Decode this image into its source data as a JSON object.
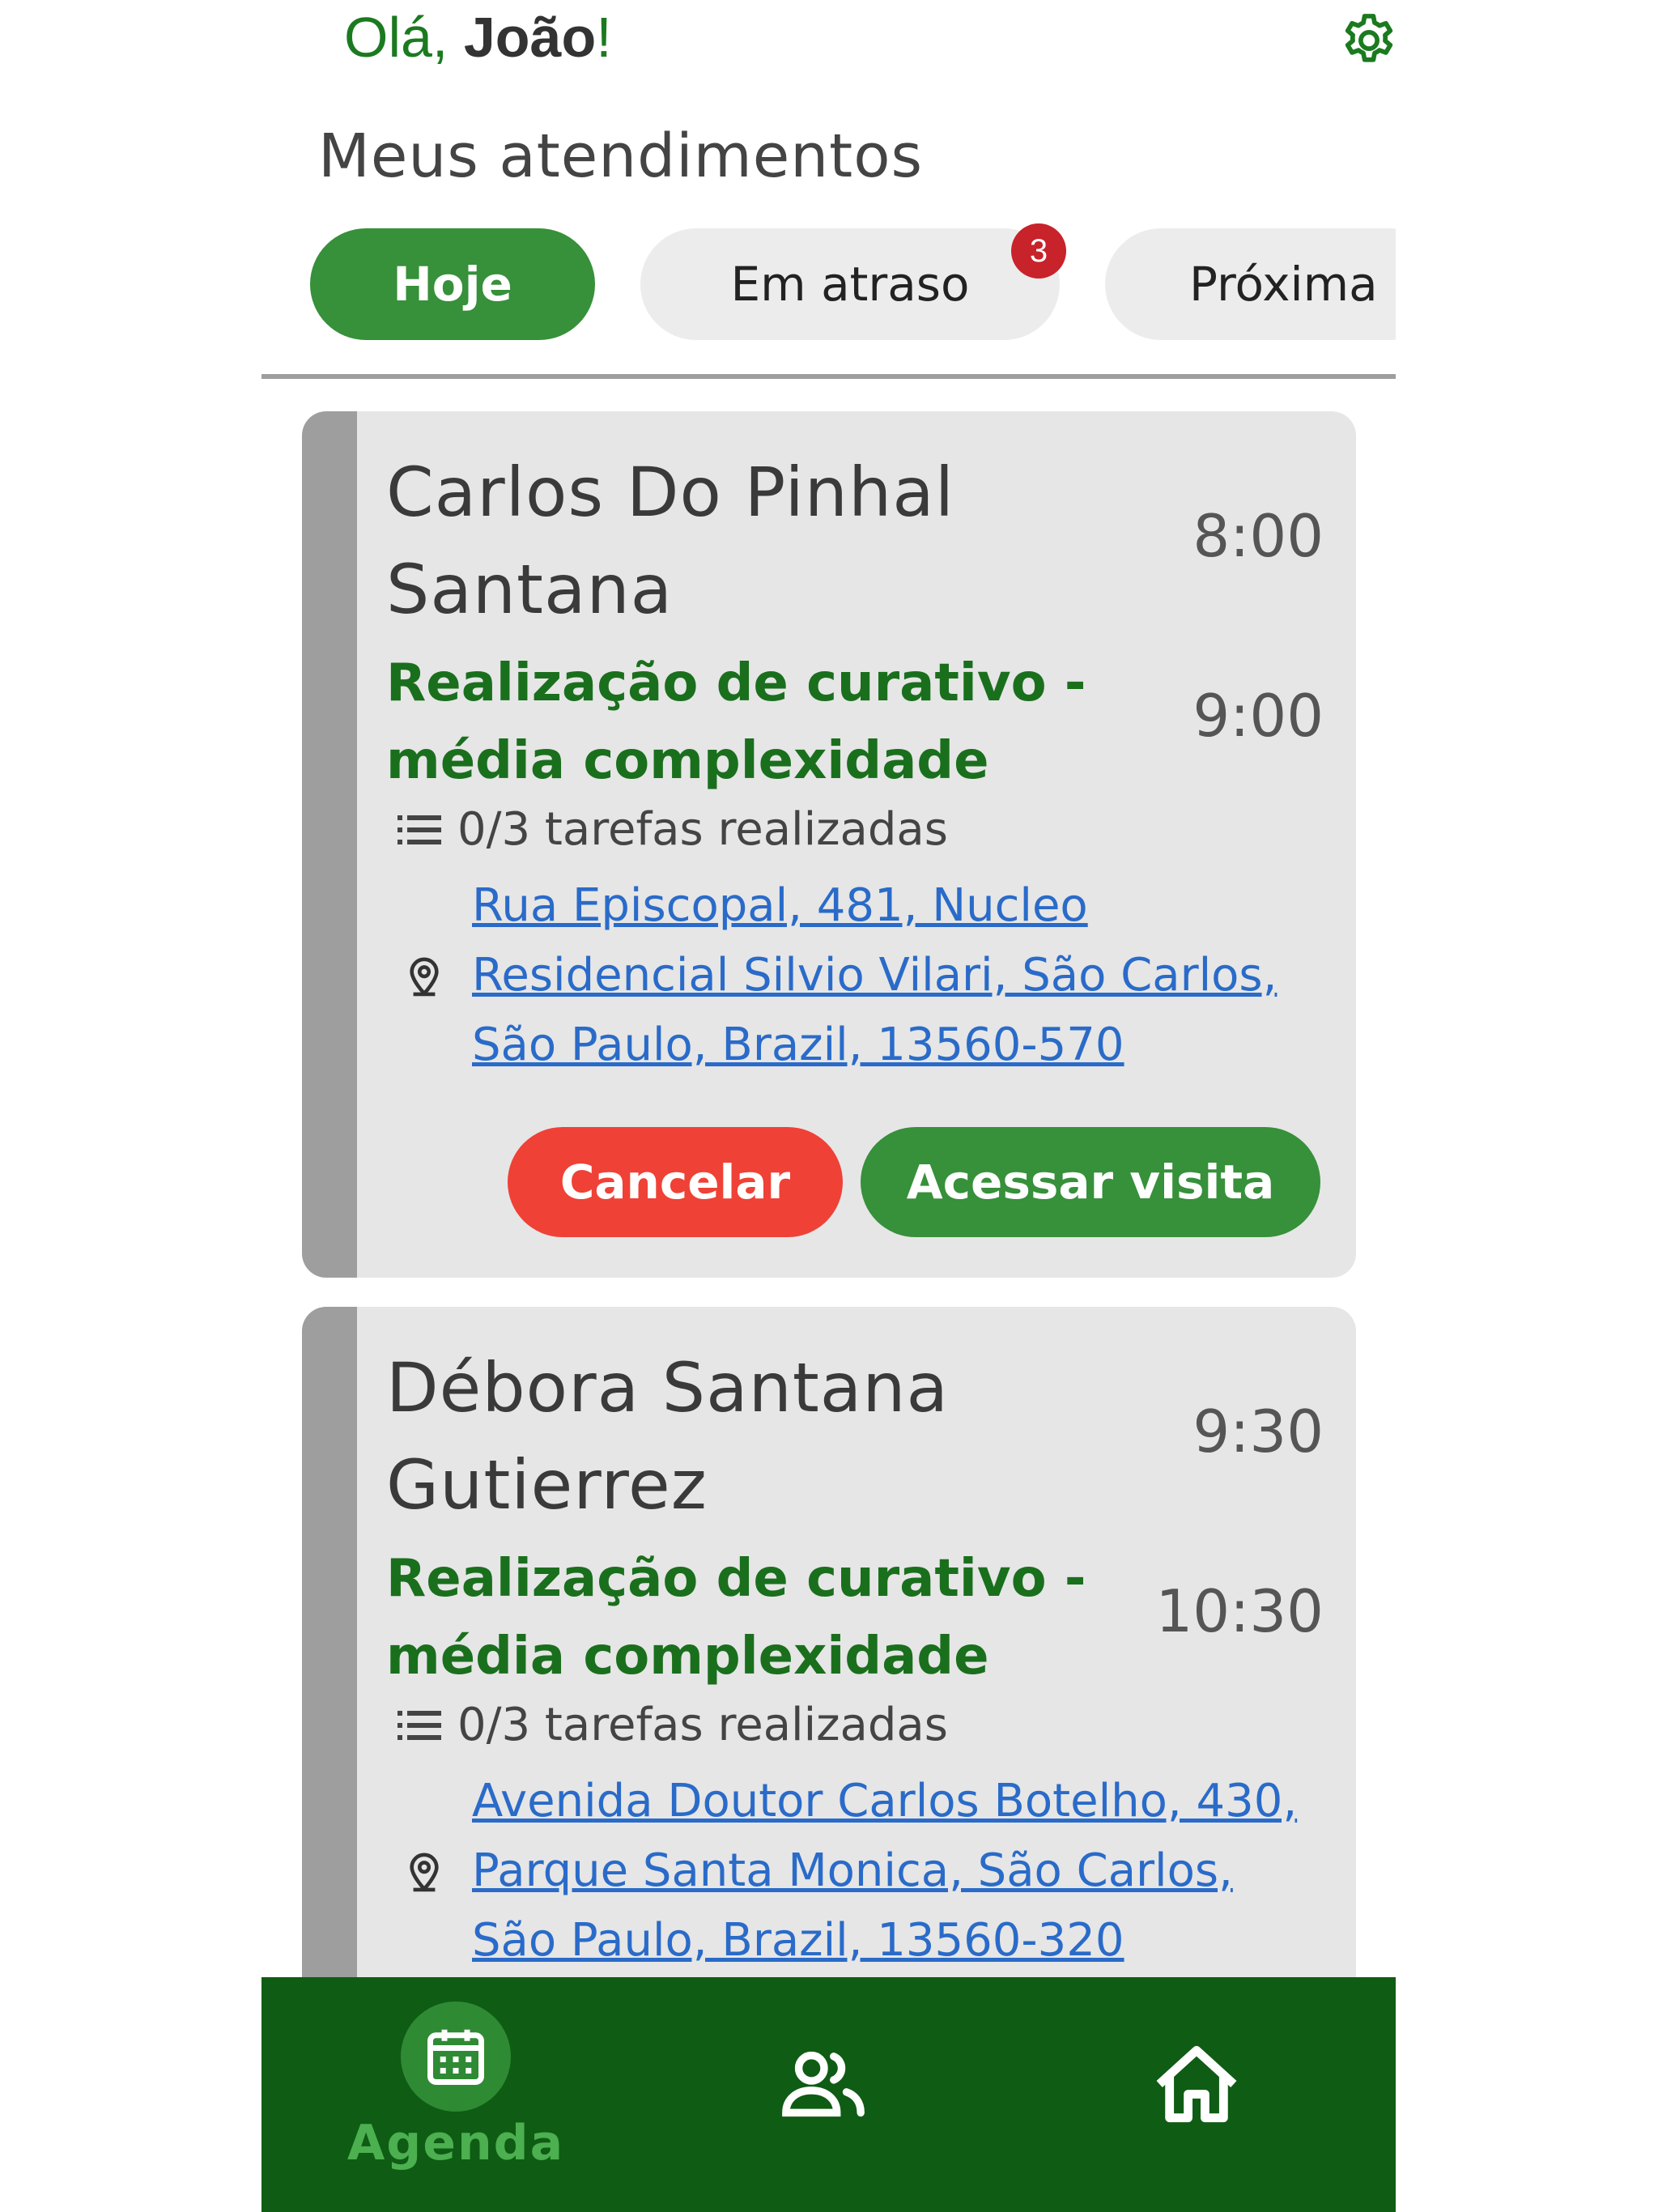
{
  "header": {
    "greeting_prefix": "Olá, ",
    "user_name": "João",
    "greeting_suffix": "!",
    "settings_icon": "gear-icon"
  },
  "section_title": "Meus atendimentos",
  "tabs": [
    {
      "label": "Hoje",
      "active": true
    },
    {
      "label": "Em atraso",
      "badge": "3"
    },
    {
      "label": "Próxima"
    }
  ],
  "appointments": [
    {
      "patient": "Carlos Do Pinhal Santana",
      "procedure": "Realização de curativo - média complexidade",
      "start_time": "8:00",
      "end_time": "9:00",
      "tasks": "0/3 tarefas realizadas",
      "address": "Rua Episcopal, 481, Nucleo Residencial Silvio Vilari, São Carlos, São Paulo, Brazil, 13560-570",
      "cancel_label": "Cancelar",
      "access_label": "Acessar visita"
    },
    {
      "patient": "Débora Santana Gutierrez",
      "procedure": "Realização de curativo - média complexidade",
      "start_time": "9:30",
      "end_time": "10:30",
      "tasks": "0/3 tarefas realizadas",
      "address": "Avenida Doutor Carlos Botelho, 430, Parque Santa Monica, São Carlos, São Paulo, Brazil, 13560-320"
    }
  ],
  "bottom_nav": {
    "items": [
      {
        "label": "Agenda",
        "icon": "calendar-icon",
        "active": true
      },
      {
        "icon": "people-icon"
      },
      {
        "icon": "home-icon"
      }
    ]
  },
  "colors": {
    "primary_green": "#37903a",
    "dark_green": "#0f5c14",
    "text_green": "#1a6f1d",
    "cancel_red": "#ef4136",
    "badge_red": "#c8222a",
    "link_blue": "#2a6bc9",
    "card_bg": "#e6e6e6"
  }
}
